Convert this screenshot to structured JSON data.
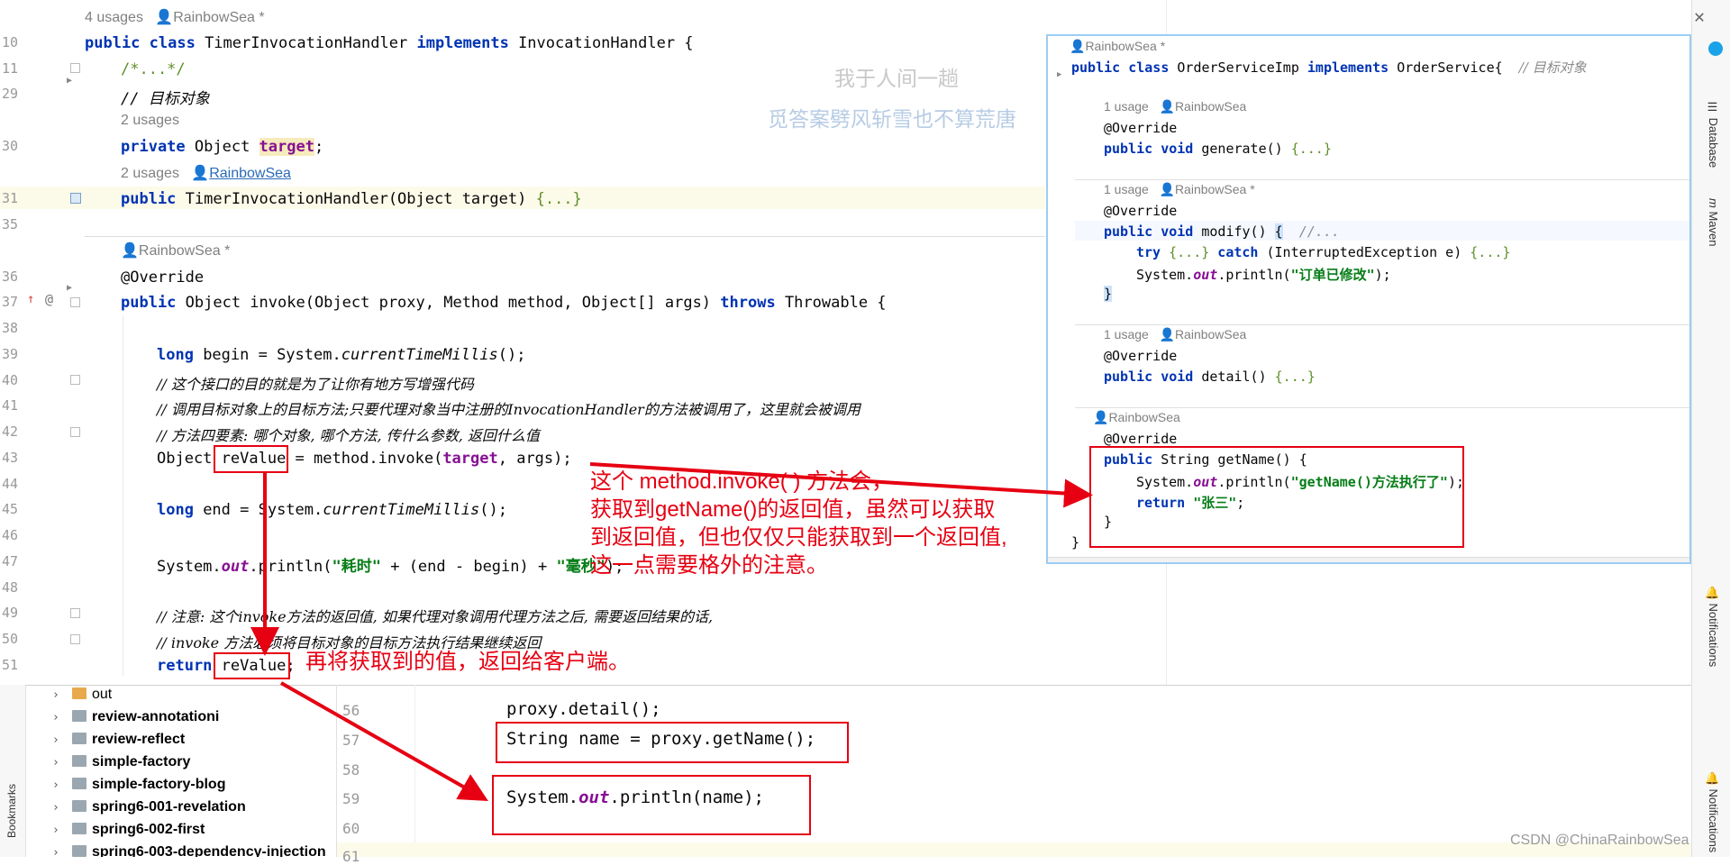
{
  "editor": {
    "lines": [
      {
        "no": "10",
        "text": ""
      },
      {
        "no": "11",
        "text": ""
      },
      {
        "no": "29",
        "text": ""
      },
      {
        "no": "30",
        "text": ""
      },
      {
        "no": "31",
        "text": ""
      },
      {
        "no": "35",
        "text": ""
      },
      {
        "no": "36",
        "text": ""
      },
      {
        "no": "37",
        "text": ""
      },
      {
        "no": "38",
        "text": ""
      },
      {
        "no": "39",
        "text": ""
      },
      {
        "no": "40",
        "text": ""
      },
      {
        "no": "41",
        "text": ""
      },
      {
        "no": "42",
        "text": ""
      },
      {
        "no": "43",
        "text": ""
      },
      {
        "no": "44",
        "text": ""
      },
      {
        "no": "45",
        "text": ""
      },
      {
        "no": "46",
        "text": ""
      },
      {
        "no": "47",
        "text": ""
      },
      {
        "no": "48",
        "text": ""
      },
      {
        "no": "49",
        "text": ""
      },
      {
        "no": "50",
        "text": ""
      },
      {
        "no": "51",
        "text": ""
      }
    ],
    "hints": {
      "class_usages": "4 usages",
      "class_author": "RainbowSea *",
      "field_usages": "2 usages",
      "ctor_usages": "2 usages",
      "ctor_author": "RainbowSea",
      "invoke_author": "RainbowSea *"
    },
    "code": {
      "l10_a": "public class ",
      "l10_b": "TimerInvocationHandler ",
      "l10_c": "implements ",
      "l10_d": "InvocationHandler {",
      "l11": "/*...*/",
      "l29": "// 目标对象",
      "l30_a": "private ",
      "l30_b": "Object ",
      "l30_c": "target",
      "l30_d": ";",
      "l31_a": "public ",
      "l31_b": "TimerInvocationHandler(Object target) ",
      "l31_c": "{...}",
      "l36": "@Override",
      "l37_a": "public ",
      "l37_b": "Object invoke(Object proxy, Method method, Object[] args) ",
      "l37_c": "throws ",
      "l37_d": "Throwable {",
      "l39_a": "long ",
      "l39_b": "begin = System.",
      "l39_c": "currentTimeMillis",
      "l39_d": "();",
      "l40": "// 这个接口的目的就是为了让你有地方写增强代码",
      "l41": "// 调用目标对象上的目标方法;只要代理对象当中注册的InvocationHandler的方法被调用了，这里就会被调用",
      "l42": "// 方法四要素: 哪个对象, 哪个方法, 传什么参数, 返回什么值",
      "l43_a": "Object ",
      "l43_b": "reValue",
      "l43_c": " = method.invoke(",
      "l43_d": "target",
      "l43_e": ", args);",
      "l45_a": "long ",
      "l45_b": "end = System.",
      "l45_c": "currentTimeMillis",
      "l45_d": "();",
      "l47_a": "System.",
      "l47_b": "out",
      "l47_c": ".println(",
      "l47_d": "\"耗时\"",
      "l47_e": " + (end - begin) + ",
      "l47_f": "\"毫秒\"",
      "l47_g": ");",
      "l49": "// 注意: 这个invoke方法的返回值, 如果代理对象调用代理方法之后, 需要返回结果的话,",
      "l50": "// invoke 方法必须将目标对象的目标方法执行结果继续返回",
      "l51_a": "return ",
      "l51_b": "reValue",
      "l51_c": ";"
    }
  },
  "watermark": {
    "line1": "我于人间一趟",
    "line2": "觅答案劈风斩雪也不算荒唐"
  },
  "popup": {
    "author_star": "RainbowSea *",
    "class_line_a": "public class ",
    "class_line_b": "OrderServiceImp ",
    "class_line_c": "implements ",
    "class_line_d": "OrderService{  ",
    "class_line_e": "// 目标对象",
    "usage1": "1 usage",
    "author": "RainbowSea",
    "override": "@Override",
    "public_void": "public void ",
    "generate": "generate() ",
    "folded": "{...}",
    "modify": "modify() ",
    "modify_brace": "{",
    "modify_cmt": "  //...",
    "try_kw": "try ",
    "catch_kw": " catch ",
    "catch_arg": "(InterruptedException e) ",
    "sys": "System.",
    "out": "out",
    "println": ".println(",
    "modify_str": "\"订单已修改\"",
    "close": ");",
    "brace_close": "}",
    "detail": "detail() ",
    "public_string": "public ",
    "string_getname": "String getName() {",
    "getname_str": "\"getName()方法执行了\"",
    "return_kw": "return ",
    "return_val": "\"张三\"",
    "semicolon": ";",
    "final_brace": "}"
  },
  "annotations": {
    "note1_l1": "这个 method.invoke( ) 方法会，",
    "note1_l2": "获取到getName()的返回值，虽然可以获取",
    "note1_l3": "到返回值，但也仅仅只能获取到一个返回值,",
    "note1_l4": "这一点需要格外的注意。",
    "note2": "再将获取到的值，返回给客户端。"
  },
  "project_tree": {
    "items": [
      "out",
      "review-annotationi",
      "review-reflect",
      "simple-factory",
      "simple-factory-blog",
      "spring6-001-revelation",
      "spring6-002-first",
      "spring6-003-dependency-injection"
    ]
  },
  "bottom_editor": {
    "line_numbers": [
      "56",
      "57",
      "58",
      "59",
      "60",
      "61"
    ],
    "l56": "proxy.detail();",
    "l57": "String name = proxy.getName();",
    "l59_a": "System.",
    "l59_b": "out",
    "l59_c": ".println(name);"
  },
  "side_tools": {
    "database": "Database",
    "maven": "Maven",
    "notifications": "Notifications",
    "bookmarks": "Bookmarks",
    "maven_glyph": "m"
  },
  "csdn": "CSDN @ChinaRainbowSea",
  "colors": {
    "accent_red": "#e60012",
    "keyword": "#0033b3",
    "field": "#871094",
    "string": "#067d17",
    "comment": "#8c8c8c"
  }
}
